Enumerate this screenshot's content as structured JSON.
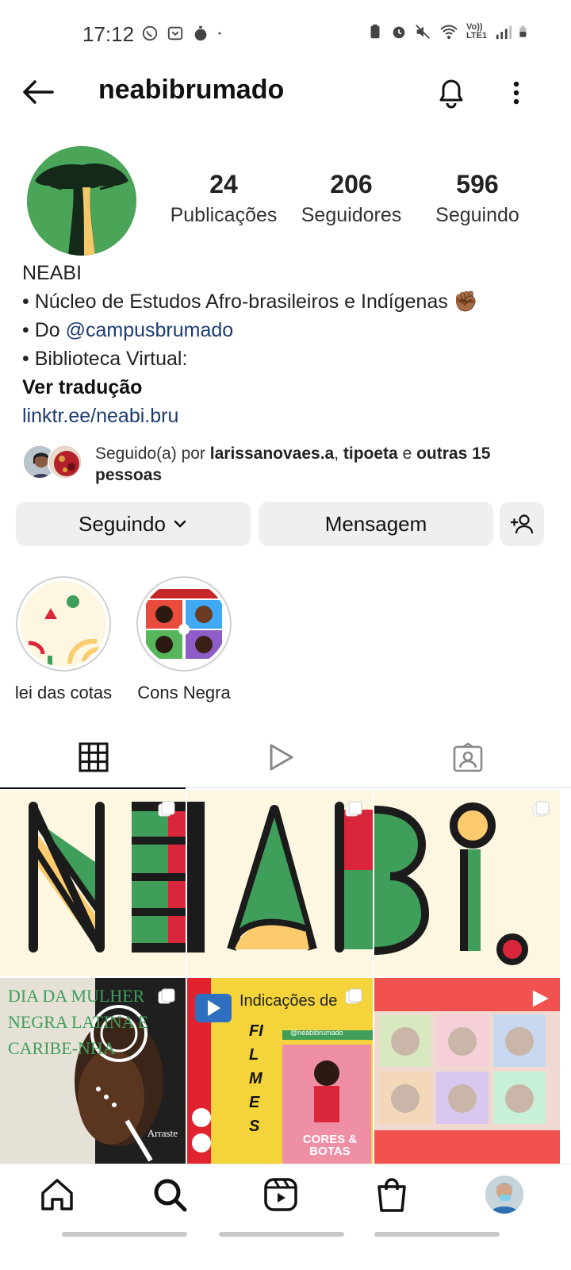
{
  "status_bar": {
    "time": "17:12",
    "network_label": "Vo)) LTE1"
  },
  "header": {
    "username": "neabibrumado"
  },
  "stats": {
    "posts_count": "24",
    "posts_label": "Publicações",
    "followers_count": "206",
    "followers_label": "Seguidores",
    "following_count": "596",
    "following_label": "Seguindo"
  },
  "bio": {
    "name": "NEABI",
    "line1": "• Núcleo de Estudos Afro-brasileiros e Indígenas ✊🏾",
    "line2_prefix": "• Do ",
    "line2_mention": "@campusbrumado",
    "line3": "• Biblioteca Virtual:",
    "translate": "Ver tradução",
    "link": "linktr.ee/neabi.bru"
  },
  "followed_by": {
    "prefix": "Seguido(a) por ",
    "user1": "larissanovaes.a",
    "sep": ", ",
    "user2": "tipoeta",
    "and": " e ",
    "others": "outras 15 pessoas"
  },
  "buttons": {
    "following": "Seguindo",
    "message": "Mensagem"
  },
  "highlights": [
    {
      "label": "lei das cotas"
    },
    {
      "label": "Cons Negra"
    }
  ],
  "posts": {
    "post4_title": "DIA DA MULHER NEGRA LATINA E CARIBE-NHA",
    "post4_hint": "Arraste",
    "post5_title": "Indicações de",
    "post5_word": "FILMES",
    "post5_handle": "@neabibrumado",
    "post5_movie": "CORES & BOTAS"
  },
  "colors": {
    "neabi_green": "#3f9e5a",
    "neabi_red": "#d9263a",
    "neabi_yellow": "#fccb6e",
    "neabi_cream": "#fdf6e0",
    "link_blue": "#1c3b70"
  },
  "icons": {
    "back": "arrow-left-icon",
    "bell": "bell-icon",
    "more": "more-vertical-icon",
    "add_person": "add-person-icon",
    "grid": "grid-icon",
    "reels": "reels-play-icon",
    "tagged": "tagged-person-icon",
    "home": "home-icon",
    "search": "search-icon",
    "reels_nav": "reels-icon",
    "shop": "shopping-bag-icon"
  }
}
